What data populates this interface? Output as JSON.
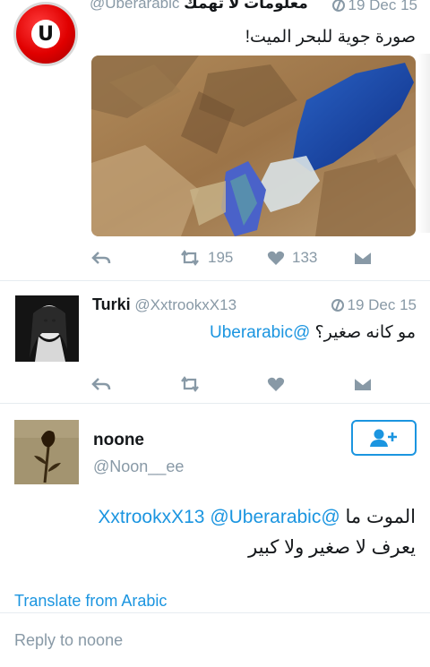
{
  "tweet1": {
    "name": "معلومات لا تهمك",
    "handle": "@Uberarabic",
    "date": "19 Dec 15",
    "text": "صورة جوية للبحر الميت!",
    "avatar_letter": "U",
    "retweets": "195",
    "likes": "133"
  },
  "tweet2": {
    "name": "Turki",
    "handle": "@XxtrookxX13",
    "date": "19 Dec 15",
    "mention": "@Uberarabic",
    "text": "مو كانه صغير؟"
  },
  "tweet3": {
    "name": "noone",
    "handle": "@Noon__ee",
    "mention1": "@XxtrookxX13",
    "mention2": "@Uberarabic",
    "text_line1": "الموت ما",
    "text_line2": "يعرف لا صغير ولا كبير",
    "translate_label": "Translate from Arabic",
    "reply_placeholder": "Reply to noone"
  },
  "colors": {
    "accent": "#1b95e0",
    "muted": "#8899a6",
    "border": "#e6ecf0"
  },
  "icons": [
    "reply-icon",
    "retweet-icon",
    "heart-icon",
    "dm-icon",
    "globe-icon",
    "follow-icon"
  ]
}
